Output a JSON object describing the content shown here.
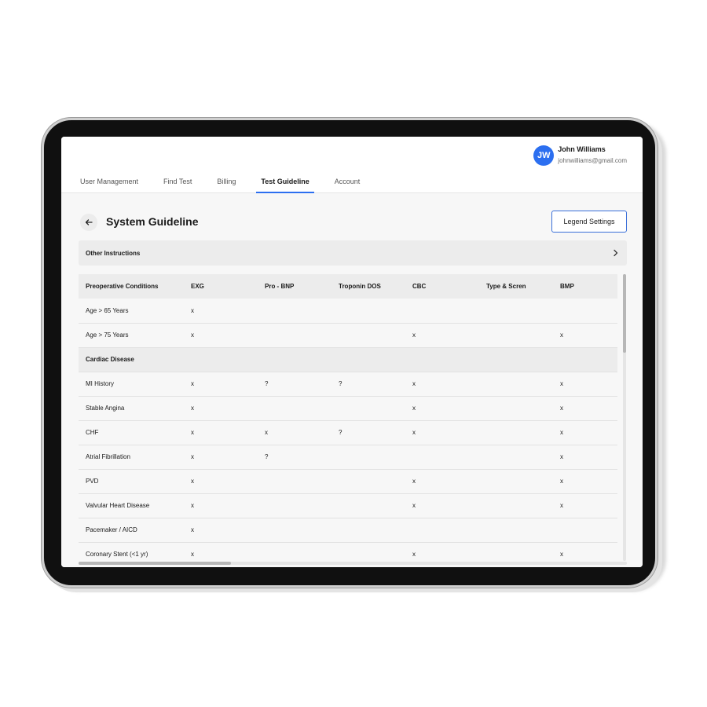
{
  "user": {
    "initials": "JW",
    "name": "John Williams",
    "email": "johnwilliams@gmail.com"
  },
  "tabs": [
    {
      "label": "User Management",
      "active": false
    },
    {
      "label": "Find Test",
      "active": false
    },
    {
      "label": "Billing",
      "active": false
    },
    {
      "label": "Test Guideline",
      "active": true
    },
    {
      "label": "Account",
      "active": false
    }
  ],
  "page": {
    "title": "System Guideline",
    "legend_button": "Legend Settings",
    "other_instructions": "Other Instructions"
  },
  "table": {
    "columns": [
      "Preoperative Conditions",
      "EXG",
      "Pro - BNP",
      "Troponin DOS",
      "CBC",
      "Type & Scren",
      "BMP"
    ],
    "rows": [
      {
        "group": false,
        "cells": [
          "Age > 65 Years",
          "x",
          "",
          "",
          "",
          "",
          ""
        ]
      },
      {
        "group": false,
        "cells": [
          "Age > 75 Years",
          "x",
          "",
          "",
          "x",
          "",
          "x"
        ]
      },
      {
        "group": true,
        "cells": [
          "Cardiac Disease",
          "",
          "",
          "",
          "",
          "",
          ""
        ]
      },
      {
        "group": false,
        "cells": [
          "MI History",
          "x",
          "?",
          "?",
          "x",
          "",
          "x"
        ]
      },
      {
        "group": false,
        "cells": [
          "Stable Angina",
          "x",
          "",
          "",
          "x",
          "",
          "x"
        ]
      },
      {
        "group": false,
        "cells": [
          "CHF",
          "x",
          "x",
          "?",
          "x",
          "",
          "x"
        ]
      },
      {
        "group": false,
        "cells": [
          "Atrial Fibrillation",
          "x",
          "?",
          "",
          "",
          "",
          "x"
        ]
      },
      {
        "group": false,
        "cells": [
          "PVD",
          "x",
          "",
          "",
          "x",
          "",
          "x"
        ]
      },
      {
        "group": false,
        "cells": [
          "Valvular Heart Disease",
          "x",
          "",
          "",
          "x",
          "",
          "x"
        ]
      },
      {
        "group": false,
        "cells": [
          "Pacemaker / AICD",
          "x",
          "",
          "",
          "",
          "",
          ""
        ]
      },
      {
        "group": false,
        "cells": [
          "Coronary Stent (<1 yr)",
          "x",
          "",
          "",
          "x",
          "",
          "x"
        ]
      }
    ]
  },
  "colors": {
    "accent": "#2c6ff0",
    "avatar_bg": "#2c6ff0",
    "header_row_bg": "#ececec",
    "body_bg": "#f7f7f7"
  },
  "icons": {
    "back": "arrow-left-icon",
    "expand": "chevron-right-icon"
  }
}
